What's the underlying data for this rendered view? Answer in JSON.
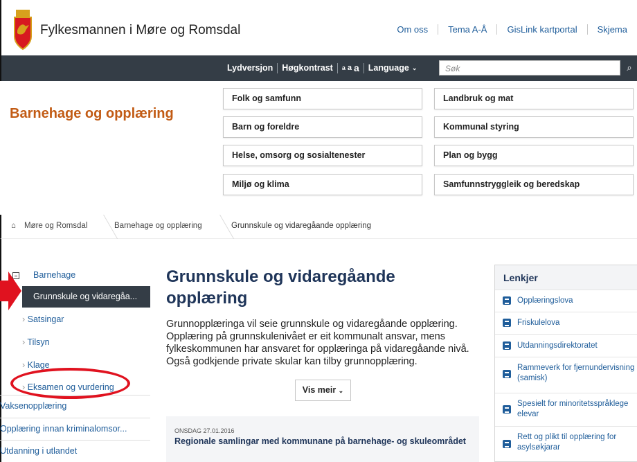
{
  "header": {
    "site_name": "Fylkesmannen i Møre og Romsdal",
    "links": [
      "Om oss",
      "Tema A-Å",
      "GisLink kartportal",
      "Skjema"
    ]
  },
  "toolbar": {
    "sound": "Lydversjon",
    "contrast": "Høgkontrast",
    "font_sizes": [
      "a",
      "a",
      "a"
    ],
    "language": "Language",
    "search_placeholder": "Søk"
  },
  "section": {
    "title": "Barnehage og opplæring"
  },
  "topics": [
    "Folk og samfunn",
    "Landbruk og mat",
    "Barn og foreldre",
    "Kommunal styring",
    "Helse, omsorg og sosialtenester",
    "Plan og bygg",
    "Miljø og klima",
    "Samfunnstryggleik og beredskap"
  ],
  "breadcrumbs": [
    "Møre og Romsdal",
    "Barnehage og opplæring",
    "Grunnskule og vidaregåande opplæring"
  ],
  "sidebar": [
    "Barnehage",
    "Grunnskule og vidaregåa...",
    "Satsingar",
    "Tilsyn",
    "Klage",
    "Eksamen og vurdering",
    "Vaksenopplæring",
    "Opplæring innan kriminalomsor...",
    "Utdanning i utlandet"
  ],
  "main": {
    "title": "Grunnskule og vidaregåande opplæring",
    "intro": "Grunnopplæringa vil seie grunnskule og vidaregåande opplæring. Opplæring på grunnskulenivået er eit kommunalt ansvar, mens fylkeskommunen har ansvaret for opplæringa på vidaregåande nivå. Også godkjende private skular kan tilby grunnopplæring.",
    "more_button": "Vis meir",
    "news": {
      "date": "ONSDAG 27.01.2016",
      "title": "Regionale samlingar med kommunane på barnehage- og skuleområdet"
    }
  },
  "links_panel": {
    "title": "Lenkjer",
    "items": [
      "Opplæringslova",
      "Friskulelova",
      "Utdanningsdirektoratet",
      "Rammeverk for fjernundervisning (samisk)",
      "Spesielt for minoritetsspråklege elevar",
      "Rett og plikt til opplæring for asylsøkjarar"
    ]
  },
  "colors": {
    "accent": "#c25b14",
    "nav_dark": "#343d46",
    "link": "#1f5d9a",
    "annotation": "#e0121f"
  }
}
